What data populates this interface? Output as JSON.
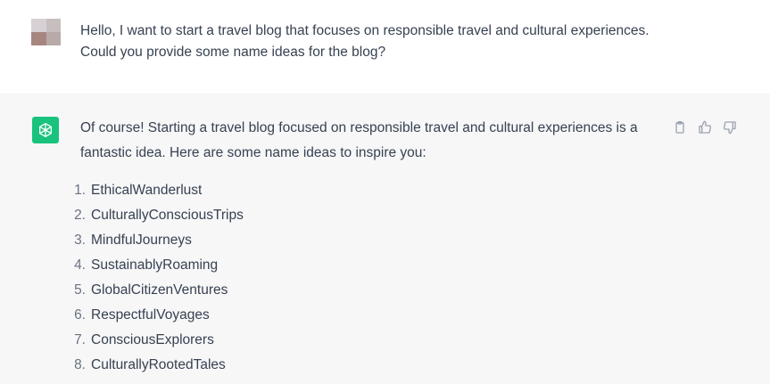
{
  "user_message": {
    "line1": "Hello, I want to start a travel blog that focuses on responsible travel and cultural experiences.",
    "line2": "Could you provide some name ideas for the blog?"
  },
  "assistant_message": {
    "intro_line1": "Of course! Starting a travel blog focused on responsible travel and cultural experiences is a",
    "intro_line2": "fantastic idea. Here are some name ideas to inspire you:",
    "items": [
      {
        "num": "1.",
        "text": "EthicalWanderlust"
      },
      {
        "num": "2.",
        "text": "CulturallyConsciousTrips"
      },
      {
        "num": "3.",
        "text": "MindfulJourneys"
      },
      {
        "num": "4.",
        "text": "SustainablyRoaming"
      },
      {
        "num": "5.",
        "text": "GlobalCitizenVentures"
      },
      {
        "num": "6.",
        "text": "RespectfulVoyages"
      },
      {
        "num": "7.",
        "text": "ConsciousExplorers"
      },
      {
        "num": "8.",
        "text": "CulturallyRootedTales"
      }
    ]
  },
  "icons": {
    "bot_avatar": "openai-logo-icon",
    "copy": "clipboard-icon",
    "like": "thumbs-up-icon",
    "dislike": "thumbs-down-icon"
  },
  "colors": {
    "bot_avatar_bg": "#19c37d",
    "assistant_bg": "#f7f7f8"
  }
}
